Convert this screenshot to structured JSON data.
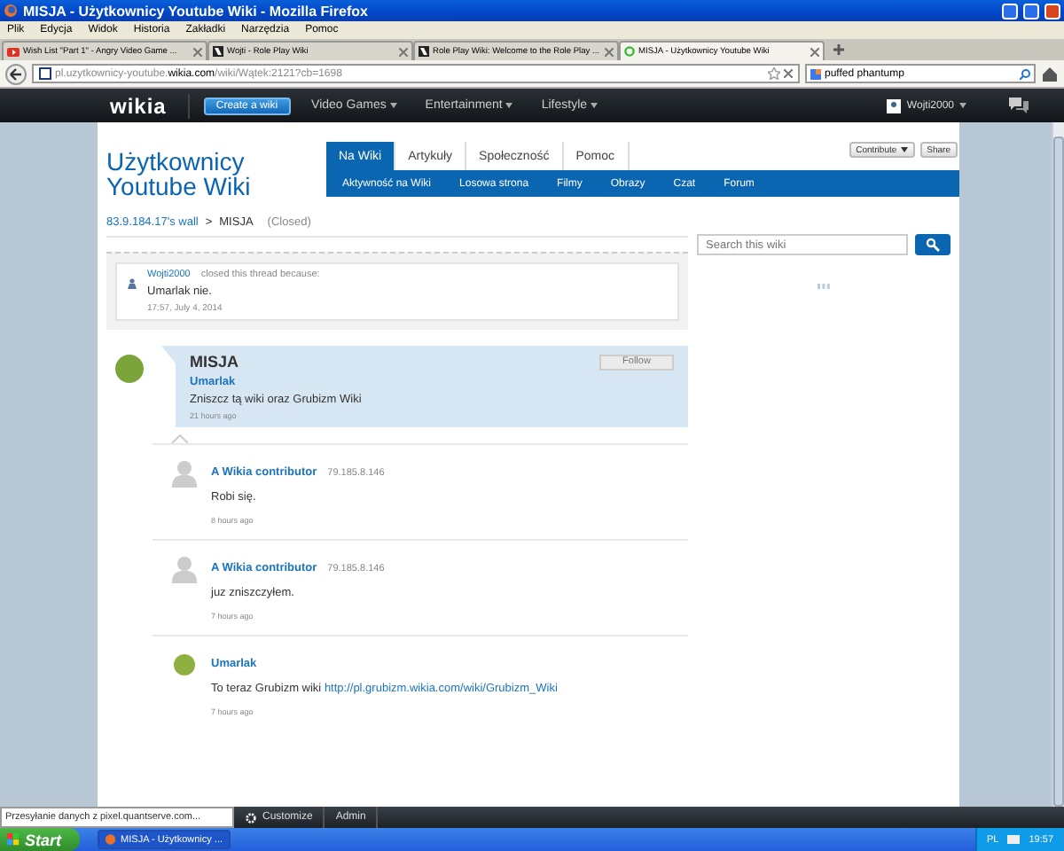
{
  "window": {
    "title": "MISJA - Użytkownicy Youtube Wiki - Mozilla Firefox"
  },
  "menu": [
    "Plik",
    "Edycja",
    "Widok",
    "Historia",
    "Zakładki",
    "Narzędzia",
    "Pomoc"
  ],
  "browser_tabs": [
    {
      "label": "Wish List \"Part 1\" - Angry Video Game ...",
      "selected": false,
      "kind": "video"
    },
    {
      "label": "Wojti - Role Play Wiki",
      "selected": false,
      "kind": "wiki"
    },
    {
      "label": "Role Play Wiki: Welcome to the Role Play ...",
      "selected": false,
      "kind": "wiki"
    },
    {
      "label": "MISJA - Użytkownicy Youtube Wiki",
      "selected": true,
      "kind": "loading"
    }
  ],
  "address_bar": {
    "host_prefix": "pl.uzytkownicy-youtube.",
    "domain": "wikia.com",
    "path": "/wiki/Wątek:2121?cb=1698"
  },
  "search_bar": {
    "value": "puffed phantump"
  },
  "wikia_header": {
    "logo": "wikia",
    "create_button": "Create a wiki",
    "nav": [
      "Video Games",
      "Entertainment",
      "Lifestyle"
    ],
    "user": "Wojti2000"
  },
  "wiki": {
    "title": "Użytkownicy Youtube Wiki",
    "tabs": [
      {
        "label": "Na Wiki",
        "selected": true
      },
      {
        "label": "Artykuły",
        "selected": false
      },
      {
        "label": "Społeczność",
        "selected": false
      },
      {
        "label": "Pomoc",
        "selected": false
      }
    ],
    "subnav": [
      "Aktywność na Wiki",
      "Losowa strona",
      "Filmy",
      "Obrazy",
      "Czat",
      "Forum"
    ],
    "contribute": "Contribute",
    "share": "Share"
  },
  "breadcrumb": {
    "wall": "83.9.184.17's wall",
    "separator": ">",
    "thread": "MISJA",
    "status": "(Closed)"
  },
  "search": {
    "placeholder": "Search this wiki"
  },
  "closed_notice": {
    "user": "Wojti2000",
    "text": "closed this thread because:",
    "reason": "Umarlak nie.",
    "time": "17:57, July 4, 2014"
  },
  "thread": {
    "title": "MISJA",
    "follow": "Follow",
    "author": "Umarlak",
    "body": "Zniszcz tą wiki oraz Grubizm Wiki",
    "time": "21 hours ago"
  },
  "replies": [
    {
      "kind": "anon",
      "author": "A Wikia contributor",
      "ip": "79.185.8.146",
      "body": "Robi się.",
      "time": "8 hours ago"
    },
    {
      "kind": "anon",
      "author": "A Wikia contributor",
      "ip": "79.185.8.146",
      "body": "juz zniszczyłem.",
      "time": "7 hours ago"
    },
    {
      "kind": "user",
      "author": "Umarlak",
      "body": "To teraz Grubizm wiki",
      "link": "http://pl.grubizm.wikia.com/wiki/Grubizm_Wiki",
      "time": "7 hours ago"
    }
  ],
  "status_text": "Przesyłanie danych z pixel.quantserve.com...",
  "toolbar": [
    "Customize",
    "Admin"
  ],
  "taskbar": {
    "start": "Start",
    "task": "MISJA - Użytkownicy ...",
    "language": "PL",
    "clock": "19:57"
  }
}
